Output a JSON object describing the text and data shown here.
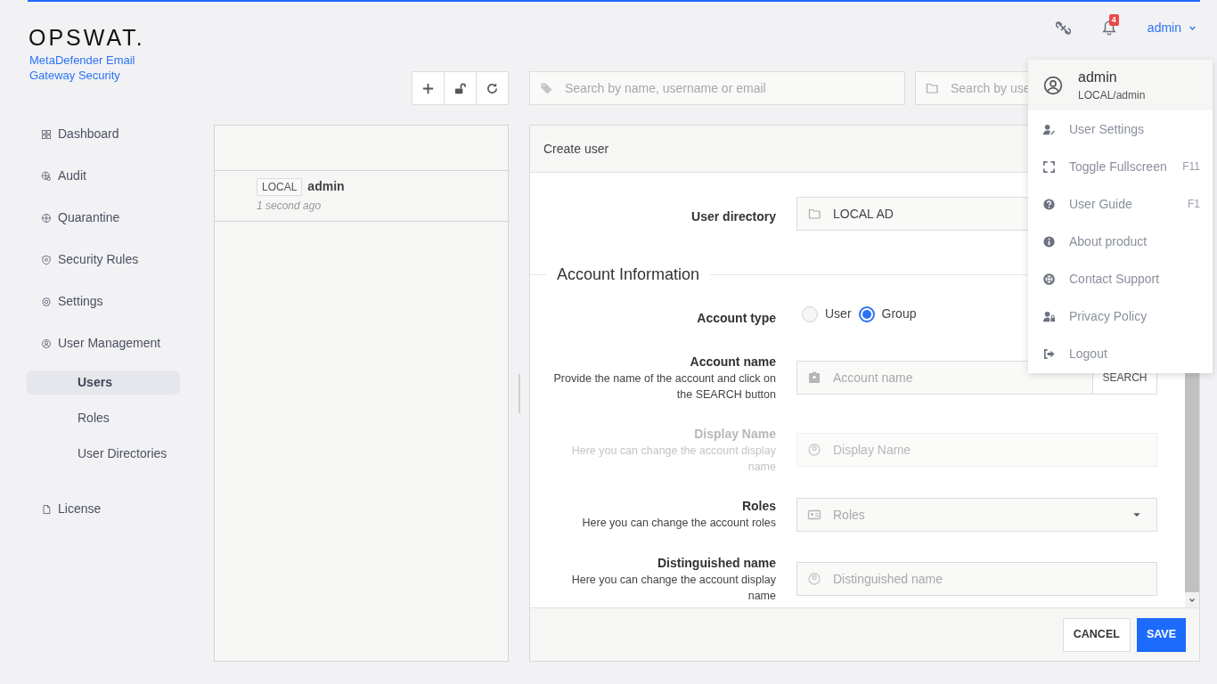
{
  "header": {
    "logo": "OPSWAT.",
    "product": "MetaDefender Email Gateway Security",
    "notification_count": "4",
    "user": "admin"
  },
  "sidebar": {
    "items": [
      {
        "label": "Dashboard",
        "selected": false
      },
      {
        "label": "Audit",
        "selected": false
      },
      {
        "label": "Quarantine",
        "selected": false
      },
      {
        "label": "Security Rules",
        "selected": false
      },
      {
        "label": "Settings",
        "selected": false
      },
      {
        "label": "User Management",
        "selected": false,
        "children": [
          {
            "label": "Users",
            "selected": true
          },
          {
            "label": "Roles",
            "selected": false
          },
          {
            "label": "User Directories",
            "selected": false
          }
        ]
      },
      {
        "label": "License",
        "selected": false
      }
    ]
  },
  "user_list": {
    "rows": [
      {
        "badge": "LOCAL",
        "name": "admin",
        "time": "1 second ago"
      }
    ]
  },
  "searches": [
    {
      "placeholder": "Search by name, username or email"
    },
    {
      "placeholder": "Search by use"
    }
  ],
  "form": {
    "title": "Create user",
    "user_directory": {
      "label": "User directory",
      "value": "LOCAL AD"
    },
    "section": "Account Information",
    "account_type": {
      "label": "Account type",
      "options": [
        {
          "label": "User",
          "selected": false
        },
        {
          "label": "Group",
          "selected": true
        }
      ]
    },
    "fields": [
      {
        "kind": "search",
        "label": "Account name",
        "help": "Provide the name of the account and click on the SEARCH button",
        "placeholder": "Account name",
        "button": "SEARCH",
        "disabled": false
      },
      {
        "kind": "text",
        "label": "Display Name",
        "help": "Here you can change the account display name",
        "placeholder": "Display Name",
        "disabled": true
      },
      {
        "kind": "select",
        "label": "Roles",
        "help": "Here you can change the account roles",
        "placeholder": "Roles",
        "disabled": false
      },
      {
        "kind": "text",
        "label": "Distinguished name",
        "help": "Here you can change the account display name",
        "placeholder": "Distinguished name",
        "disabled": false
      }
    ],
    "buttons": [
      {
        "kind": "secondary",
        "label": "CANCEL"
      },
      {
        "kind": "primary",
        "label": "SAVE"
      }
    ]
  },
  "user_menu": {
    "name": "admin",
    "account": "LOCAL/admin",
    "items": [
      {
        "label": "User Settings"
      },
      {
        "label": "Toggle Fullscreen",
        "shortcut": "F11"
      },
      {
        "label": "User Guide",
        "shortcut": "F1"
      },
      {
        "label": "About product"
      },
      {
        "label": "Contact Support"
      },
      {
        "label": "Privacy Policy"
      },
      {
        "label": "Logout"
      }
    ]
  }
}
